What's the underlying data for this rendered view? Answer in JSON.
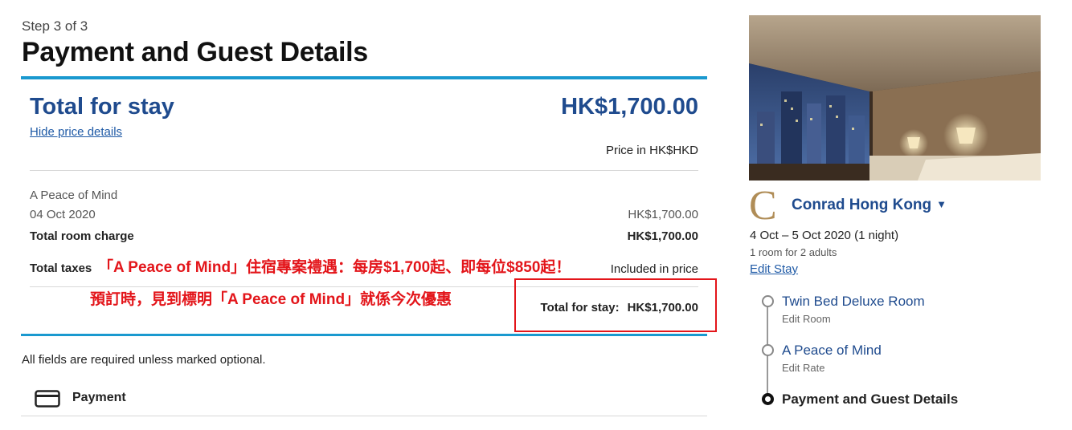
{
  "header": {
    "step": "Step 3 of 3",
    "title": "Payment and Guest Details"
  },
  "summary": {
    "title": "Total for stay",
    "amount": "HK$1,700.00",
    "hide_link": "Hide price details",
    "price_in": "Price in HK$HKD",
    "rate_name": "A Peace of Mind",
    "nights": [
      {
        "date": "04 Oct 2020",
        "amount": "HK$1,700.00"
      }
    ],
    "room_charge_label": "Total room charge",
    "room_charge_amount": "HK$1,700.00",
    "taxes_label": "Total taxes",
    "taxes_value": "Included in price",
    "total_stay_label": "Total for stay:",
    "total_stay_amount": "HK$1,700.00"
  },
  "annotations": {
    "line1": "「A Peace of Mind」住宿專案禮遇：每房$1,700起、即每位$850起！",
    "line2": "預訂時，見到標明「A Peace of Mind」就係今次優惠",
    "color": "#e3151a"
  },
  "form": {
    "required_note": "All fields are required unless marked optional.",
    "payment_label": "Payment",
    "payment_icon": "credit-card-icon"
  },
  "sidebar": {
    "logo_letter": "C",
    "hotel_name": "Conrad Hong Kong",
    "stay_dates": "4 Oct – 5 Oct 2020 (1 night)",
    "room_guests": "1 room for 2 adults",
    "edit_stay": "Edit Stay",
    "steps": [
      {
        "title": "Twin Bed Deluxe Room",
        "sub": "Edit Room"
      },
      {
        "title": "A Peace of Mind",
        "sub": "Edit Rate"
      },
      {
        "title": "Payment and Guest Details"
      }
    ]
  },
  "colors": {
    "accent_blue": "#1a99cf",
    "brand_navy": "#1f4b8e",
    "logo_gold": "#b08d57"
  }
}
